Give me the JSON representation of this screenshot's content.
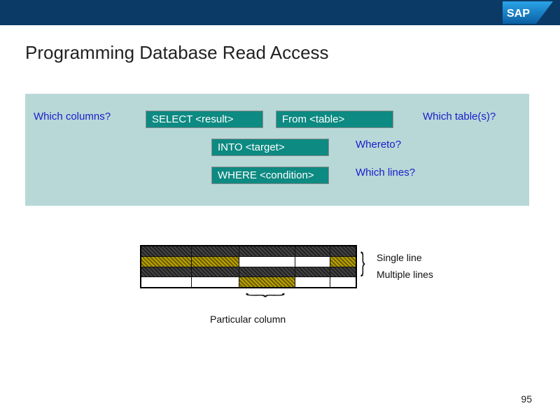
{
  "brand": "SAP",
  "title": "Programming Database Read Access",
  "questions": {
    "columns": "Which columns?",
    "tables": "Which table(s)?",
    "whereto": "Whereto?",
    "lines": "Which lines?"
  },
  "clauses": {
    "select": "SELECT <result>",
    "from": "From <table>",
    "into": "INTO <target>",
    "where": "WHERE <condition>"
  },
  "diagram": {
    "single": "Single line",
    "multiple": "Multiple lines",
    "column": "Particular column"
  },
  "page": "95"
}
